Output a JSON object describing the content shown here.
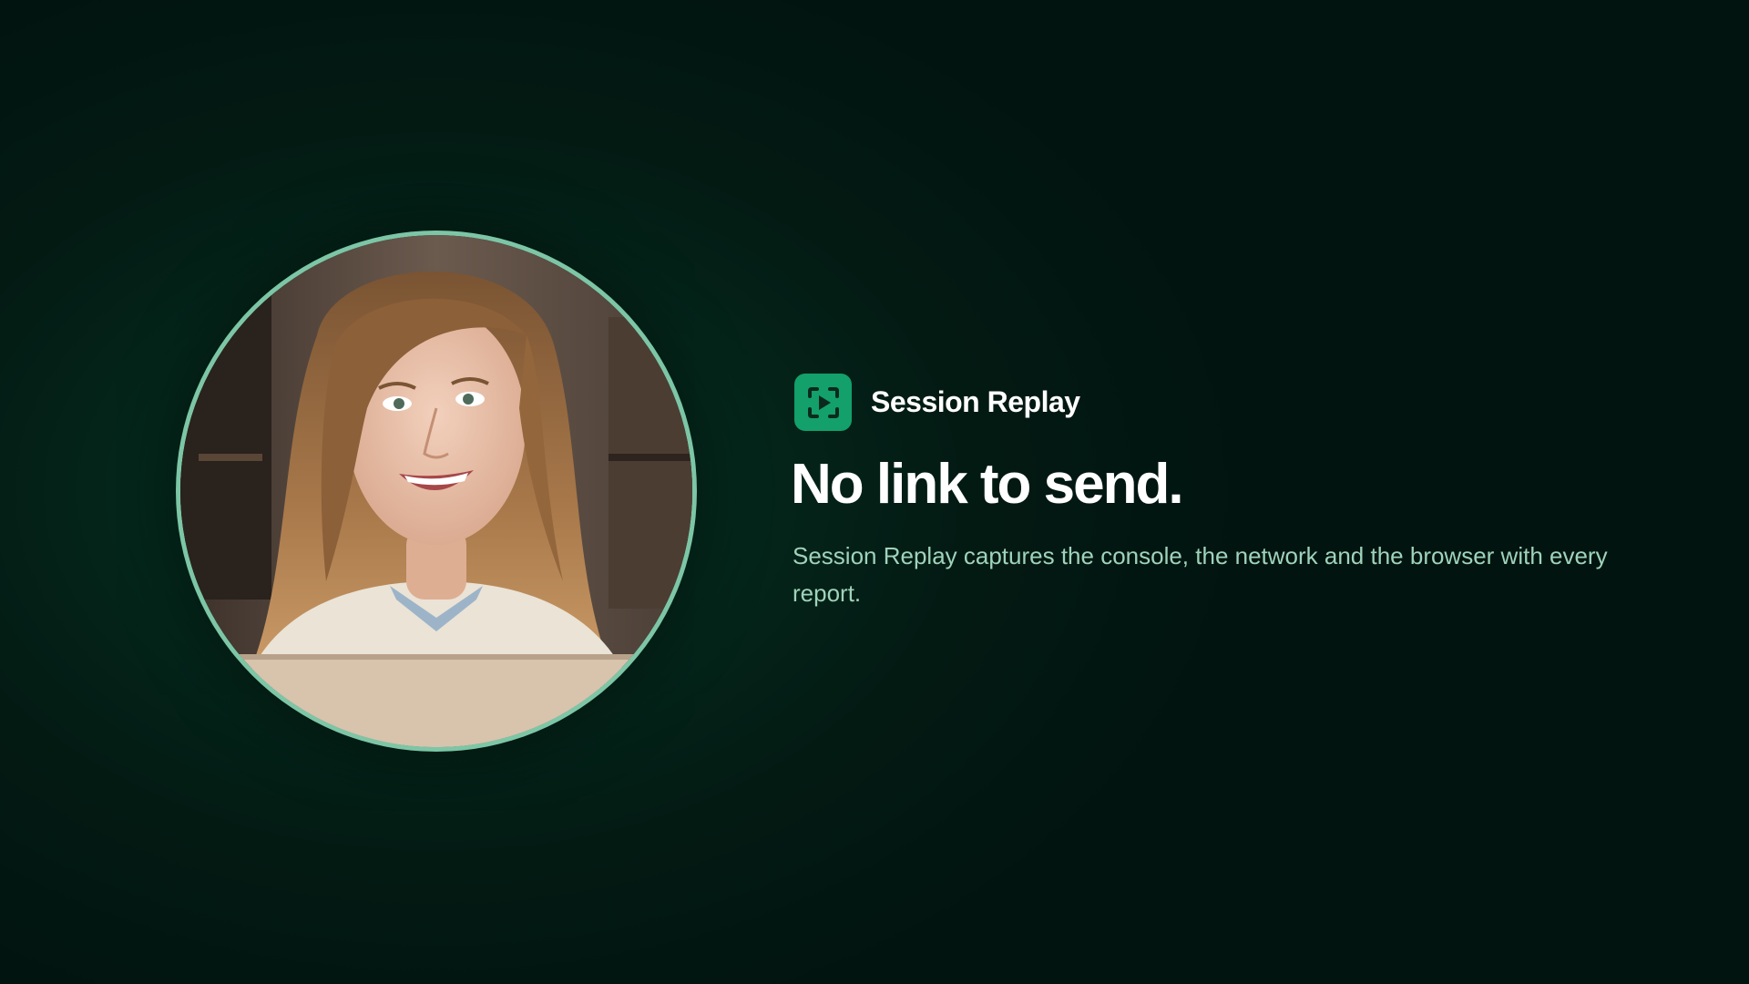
{
  "brand": {
    "name": "Session Replay",
    "icon": "session-replay-icon",
    "accent_color": "#13a06b"
  },
  "hero": {
    "headline": "No link to send.",
    "description": "Session Replay captures the console, the network and the browser with every report."
  },
  "avatar": {
    "ring_color": "#7cc6a6"
  },
  "colors": {
    "background": "#031a13",
    "headline": "#ffffff",
    "description": "#9fd3bb"
  }
}
